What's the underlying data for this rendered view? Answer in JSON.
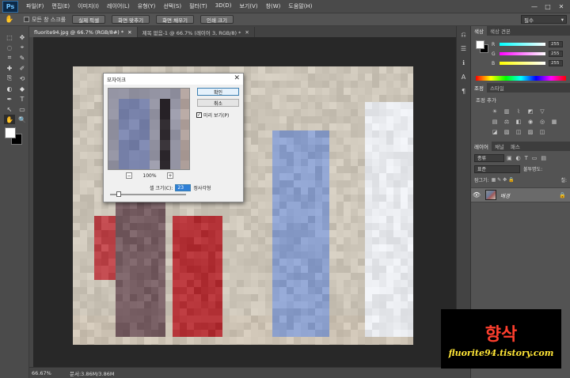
{
  "app": {
    "logo": "Ps"
  },
  "menu": [
    "파일(F)",
    "편집(E)",
    "이미지(I)",
    "레이어(L)",
    "유형(Y)",
    "선택(S)",
    "필터(T)",
    "3D(D)",
    "보기(V)",
    "창(W)",
    "도움말(H)"
  ],
  "window_controls": [
    "—",
    "□",
    "✕"
  ],
  "options": {
    "scroll_all_label": "모든 창 스크롤",
    "buttons": [
      "실제 픽셀",
      "화면 맞추기",
      "화면 채우기",
      "인쇄 크기"
    ],
    "workspace": "필수"
  },
  "document_tabs": [
    {
      "label": "fluorite94.jpg @ 66.7% (RGB/8#) *",
      "active": true
    },
    {
      "label": "제목 없음-1 @ 66.7% (레이어 3, RGB/8) *",
      "active": false
    }
  ],
  "status": {
    "zoom": "66.67%",
    "doc_info": "문서:3.86M/3.86M"
  },
  "tools": [
    "⬚",
    "✥",
    "◌",
    "⌖",
    "⌗",
    "✎",
    "✚",
    "✐",
    "⎘",
    "⟲",
    "◐",
    "◆",
    "✒",
    "T",
    "↖",
    "▭",
    "✋",
    "🔍"
  ],
  "color_panel": {
    "tabs": [
      "색상",
      "색상 견본"
    ],
    "channels": [
      {
        "name": "R",
        "value": "255",
        "gradient": "linear-gradient(90deg,#00ffff,#ffffff)"
      },
      {
        "name": "G",
        "value": "255",
        "gradient": "linear-gradient(90deg,#ff00ff,#ffffff)"
      },
      {
        "name": "B",
        "value": "255",
        "gradient": "linear-gradient(90deg,#ffff00,#ffffff)"
      }
    ]
  },
  "adjust_panel": {
    "tabs": [
      "조정",
      "스타일"
    ],
    "title": "조정 추가"
  },
  "layers_panel": {
    "tabs": [
      "레이어",
      "채널",
      "패스"
    ],
    "kind": "종류",
    "blend_mode": "표준",
    "opacity_label": "불투명도:",
    "lock_label": "잠그기:",
    "fill_label": "칠:",
    "layer_name": "배경"
  },
  "dialog": {
    "title": "모자이크",
    "ok": "확인",
    "cancel": "취소",
    "preview_label": "미리 보기(P)",
    "zoom": "100%",
    "zoom_minus": "−",
    "zoom_plus": "+",
    "cell_label": "셀 크기(C):",
    "cell_value": "23",
    "cell_unit": "정사각형"
  },
  "watermark": {
    "title": "향삭",
    "url": "fluorite94.tistory.com"
  }
}
